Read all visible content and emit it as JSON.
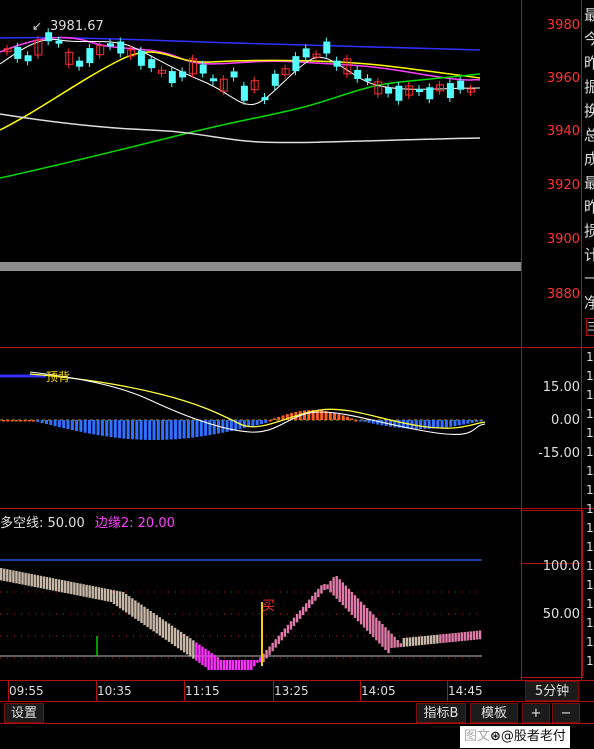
{
  "price_axis": {
    "ticks": [
      "3980",
      "3960",
      "3940",
      "3920",
      "3900",
      "3880"
    ]
  },
  "price_high_label": "3981.67",
  "macd_axis": {
    "ticks": [
      "15.00",
      "0.00",
      "-15.00"
    ]
  },
  "macd_tag": "顶背",
  "indicator": {
    "line1_label": "多空线: 50.00",
    "line2_label": "边缘2: 20.00",
    "ticks": [
      "100.0",
      "50.00"
    ],
    "buy_mark": "买"
  },
  "time_axis": {
    "ticks": [
      "09:55",
      "10:35",
      "11:15",
      "13:25",
      "14:05",
      "14:45"
    ]
  },
  "period_label": "5分钟",
  "bottom_bar": {
    "settings": "设置",
    "indicator_b": "指标B",
    "template": "模板",
    "plus": "+",
    "minus": "−"
  },
  "right_panel_chars": [
    "最",
    "今",
    "昨",
    "振",
    "换",
    "总",
    "成",
    "最",
    "昨",
    "损",
    "计",
    "—",
    "净"
  ],
  "right_panel_box": "三",
  "right_panel_ones": [
    "1",
    "1",
    "1",
    "1",
    "1",
    "1",
    "1",
    "1",
    "1",
    "1",
    "1",
    "1",
    "1",
    "1",
    "1",
    "1",
    "1"
  ],
  "watermark": "@股者老付",
  "watermark_prefix": "图文",
  "colors": {
    "up": "#ff3030",
    "down": "#55ffff",
    "axis": "#b01010",
    "ma_white": "#ffffff",
    "ma_yellow": "#ffff00",
    "ma_magenta": "#ff40ff",
    "ma_green": "#00dd00",
    "ma_blue": "#3030ff"
  }
}
